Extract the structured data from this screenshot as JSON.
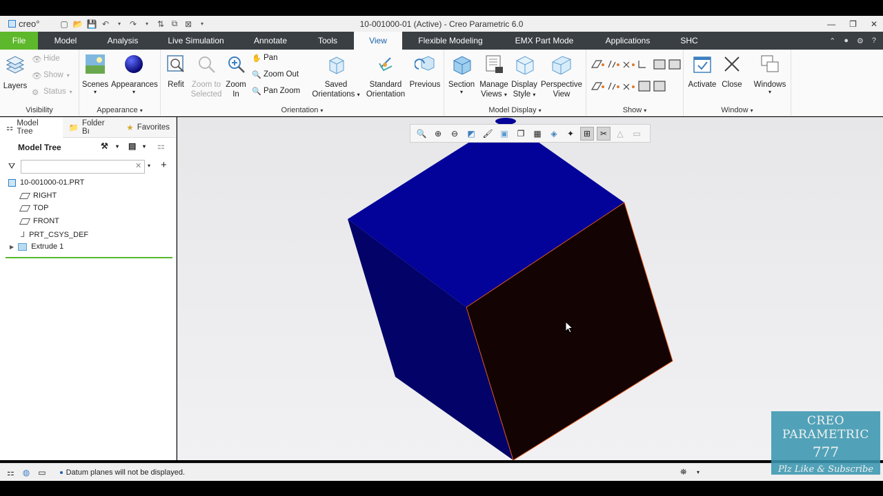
{
  "app": {
    "logo_text": "creo°",
    "window_title": "10-001000-01 (Active) - Creo Parametric 6.0"
  },
  "tabs": [
    {
      "label": "File"
    },
    {
      "label": "Model"
    },
    {
      "label": "Analysis"
    },
    {
      "label": "Live Simulation"
    },
    {
      "label": "Annotate"
    },
    {
      "label": "Tools"
    },
    {
      "label": "View"
    },
    {
      "label": "Flexible Modeling"
    },
    {
      "label": "EMX Part Mode"
    },
    {
      "label": "Applications"
    },
    {
      "label": "SHC"
    }
  ],
  "ribbon": {
    "visibility": {
      "layers": "Layers",
      "hide": "Hide",
      "show": "Show",
      "status": "Status",
      "group": "Visibility"
    },
    "appearance": {
      "scenes": "Scenes",
      "appearances": "Appearances",
      "group": "Appearance"
    },
    "orientation": {
      "refit": "Refit",
      "zoom_to_selected_1": "Zoom to",
      "zoom_to_selected_2": "Selected",
      "zoom_in_1": "Zoom",
      "zoom_in_2": "In",
      "pan": "Pan",
      "zoom_out": "Zoom Out",
      "pan_zoom": "Pan Zoom",
      "saved_1": "Saved",
      "saved_2": "Orientations",
      "standard_1": "Standard",
      "standard_2": "Orientation",
      "previous": "Previous",
      "group": "Orientation"
    },
    "model_display": {
      "section": "Section",
      "manage_1": "Manage",
      "manage_2": "Views",
      "display_1": "Display",
      "display_2": "Style",
      "perspective_1": "Perspective",
      "perspective_2": "View",
      "group": "Model Display"
    },
    "show": {
      "group": "Show"
    },
    "window": {
      "activate": "Activate",
      "close": "Close",
      "windows": "Windows",
      "group": "Window"
    }
  },
  "panel": {
    "tabs": {
      "model_tree": "Model Tree",
      "folder_browser": "Folder Bı",
      "favorites": "Favorites"
    },
    "header": "Model Tree",
    "search_placeholder": "",
    "items": [
      {
        "label": "10-001000-01.PRT"
      },
      {
        "label": "RIGHT"
      },
      {
        "label": "TOP"
      },
      {
        "label": "FRONT"
      },
      {
        "label": "PRT_CSYS_DEF"
      },
      {
        "label": "Extrude 1"
      }
    ]
  },
  "status": {
    "message": "Datum planes will not be displayed."
  },
  "colors": {
    "accent": "#1a62a8",
    "file_tab": "#5eb82b",
    "tab_bar": "#3a3f44",
    "cube_top": "#03039a",
    "cube_left": "#020268",
    "cube_right": "#130303",
    "edge_highlight": "#e55a1c"
  },
  "watermark": {
    "line1": "CREO PARAMETRIC",
    "line2": "777",
    "line3": "Plz Like & Subscribe"
  }
}
